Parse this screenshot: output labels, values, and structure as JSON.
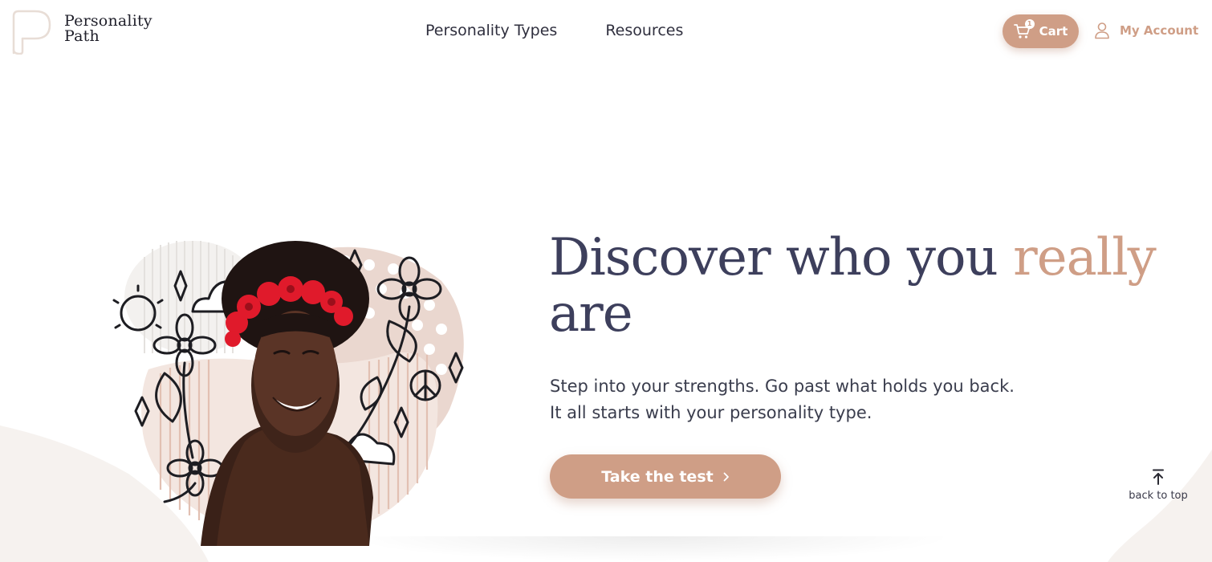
{
  "brand": {
    "name_line1": "Personality",
    "name_line2": "Path",
    "accent_color": "#cf9e86",
    "text_color": "#3d3f5c"
  },
  "nav": {
    "items": [
      {
        "label": "Personality Types"
      },
      {
        "label": "Resources"
      }
    ]
  },
  "header": {
    "cart_label": "Cart",
    "cart_count": "1",
    "account_label": "My Account",
    "cart_icon": "cart-icon",
    "account_icon": "user-icon"
  },
  "hero": {
    "headline_main": "Discover who you ",
    "headline_accent": "really",
    "headline_end": "are",
    "subtext_line1": "Step into your strengths. Go past what holds you back.",
    "subtext_line2": "It all starts with your personality type.",
    "cta_label": "Take the test",
    "cta_icon": "chevron-right-icon"
  },
  "back_to_top": {
    "label": "back to top",
    "icon": "arrow-up-icon"
  }
}
